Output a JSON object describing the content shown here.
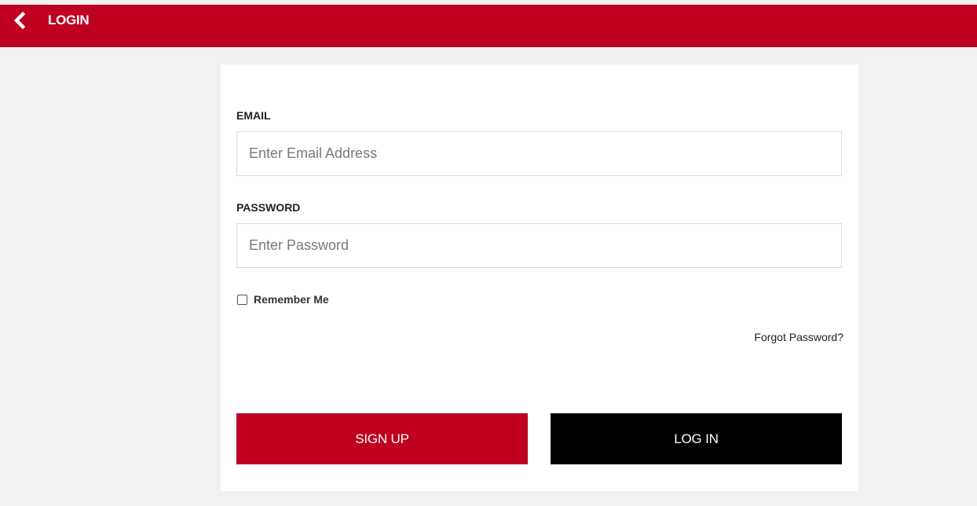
{
  "header": {
    "title": "LOGIN",
    "back_icon": "chevron-left-icon",
    "background_color": "#bf0020"
  },
  "form": {
    "email": {
      "label": "EMAIL",
      "placeholder": "Enter Email Address",
      "value": ""
    },
    "password": {
      "label": "PASSWORD",
      "placeholder": "Enter Password",
      "value": ""
    },
    "remember_me": {
      "label": "Remember Me",
      "checked": false
    },
    "forgot_password": "Forgot Password?",
    "signup_button": "SIGN UP",
    "login_button": "LOG IN"
  },
  "colors": {
    "accent": "#bf0020",
    "login_button": "#000000",
    "page_background": "#f1f1f1"
  }
}
